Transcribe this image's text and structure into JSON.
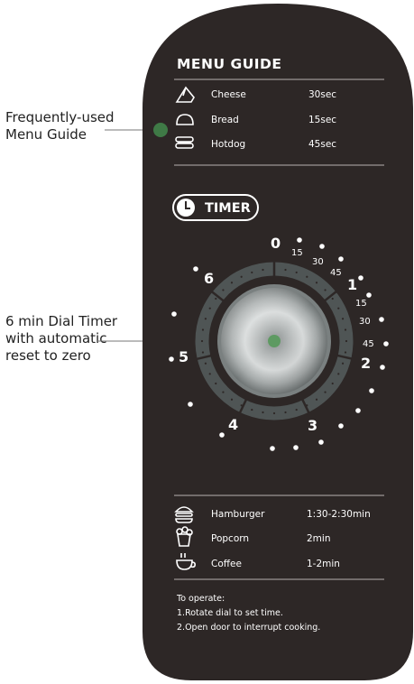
{
  "annotations": {
    "menu_guide_line1": "Frequently-used",
    "menu_guide_line2": "Menu Guide",
    "dial_line1": "6 min Dial Timer",
    "dial_line2": "with automatic",
    "dial_line3": "reset to zero"
  },
  "menu_guide": {
    "title": "MENU GUIDE",
    "items": [
      {
        "icon": "cheese-icon",
        "name": "Cheese",
        "time": "30sec"
      },
      {
        "icon": "bread-icon",
        "name": "Bread",
        "time": "15sec"
      },
      {
        "icon": "hotdog-icon",
        "name": "Hotdog",
        "time": "45sec"
      }
    ]
  },
  "timer": {
    "label": "TIMER",
    "icon": "clock-icon",
    "marks": {
      "zero": "0",
      "zero_15": "15",
      "zero_30": "30",
      "zero_45": "45",
      "one": "1",
      "one_15": "15",
      "one_30": "30",
      "one_45": "45",
      "two": "2",
      "three": "3",
      "four": "4",
      "five": "5",
      "six": "6"
    }
  },
  "more_menu": {
    "items": [
      {
        "icon": "hamburger-icon",
        "name": "Hamburger",
        "time": "1:30-2:30min"
      },
      {
        "icon": "popcorn-icon",
        "name": "Popcorn",
        "time": "2min"
      },
      {
        "icon": "coffee-icon",
        "name": "Coffee",
        "time": "1-2min"
      }
    ]
  },
  "instructions": {
    "heading": "To operate:",
    "step1": "1.Rotate dial to set time.",
    "step2": "2.Open door to interrupt cooking."
  },
  "colors": {
    "panel": "#2d2726",
    "ring": "#4f5555",
    "indicator": "#5e9a62",
    "callout_dot": "#3f7a46"
  }
}
